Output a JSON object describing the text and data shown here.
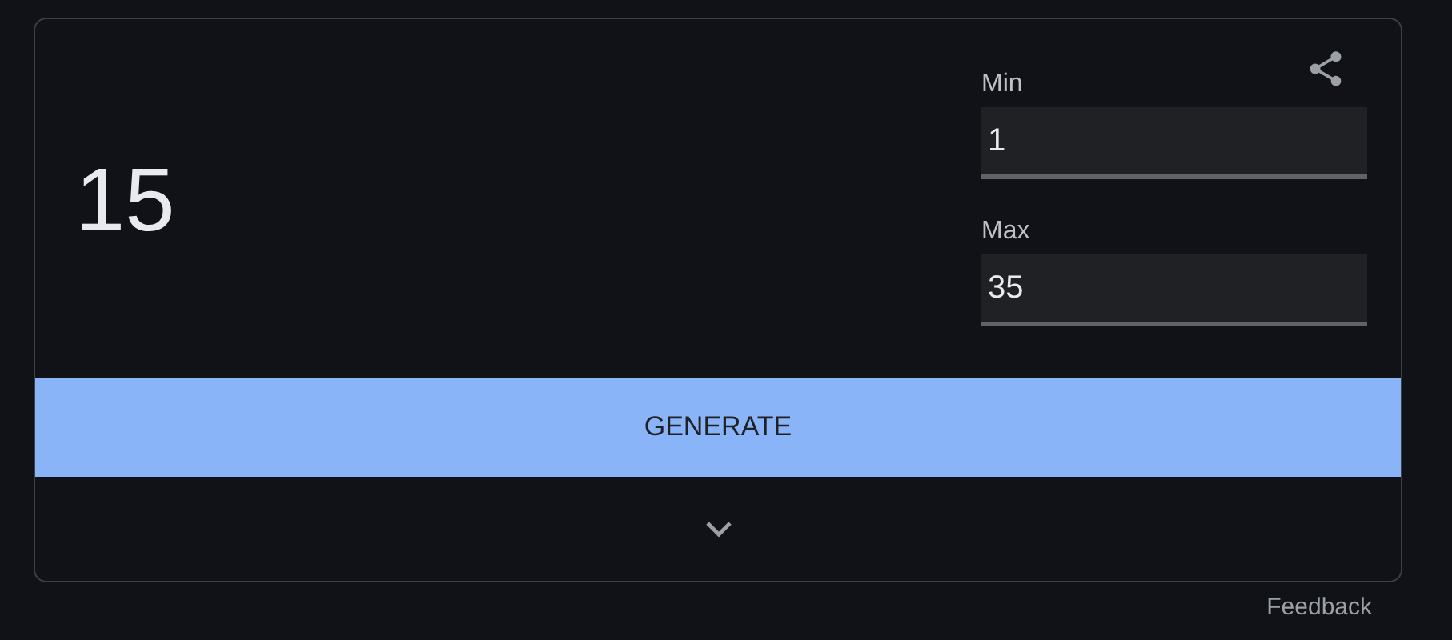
{
  "result": "15",
  "fields": [
    {
      "label": "Min",
      "value": "1"
    },
    {
      "label": "Max",
      "value": "35"
    }
  ],
  "generate_button": "GENERATE",
  "feedback_link": "Feedback"
}
